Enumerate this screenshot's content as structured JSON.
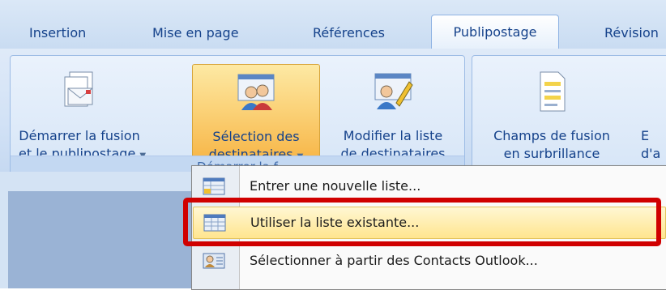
{
  "tabs": [
    {
      "label": "Insertion"
    },
    {
      "label": "Mise en page"
    },
    {
      "label": "Références"
    },
    {
      "label": "Publipostage",
      "active": true
    },
    {
      "label": "Révision"
    }
  ],
  "group1": {
    "footer": "Démarrer la f",
    "start_merge": {
      "line1": "Démarrer la fusion",
      "line2": "et le publipostage"
    },
    "select_recipients": {
      "line1": "Sélection des",
      "line2": "destinataires"
    },
    "edit_list": {
      "line1": "Modifier la liste",
      "line2": "de destinataires"
    }
  },
  "group2": {
    "highlight_fields": {
      "line1": "Champs de fusion",
      "line2": "en surbrillance"
    },
    "partial": {
      "line1": "E",
      "line2": "d'a"
    }
  },
  "menu": {
    "items": [
      {
        "label": "Entrer une nouvelle liste...",
        "icon": "new-list-icon"
      },
      {
        "label": "Utiliser la liste existante...",
        "icon": "existing-list-icon",
        "highlighted": true
      },
      {
        "label": "Sélectionner à partir des Contacts Outlook...",
        "icon": "outlook-contacts-icon"
      }
    ]
  },
  "colors": {
    "highlight_box": "#d00000",
    "active_button": "#fbd37a"
  }
}
